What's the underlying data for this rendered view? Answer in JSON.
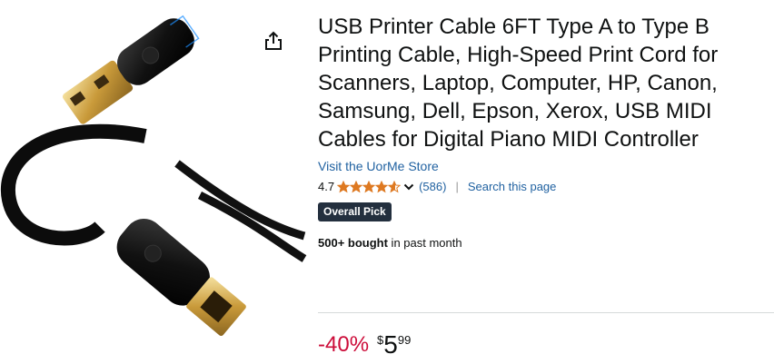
{
  "product": {
    "title": "USB Printer Cable 6FT Type A to Type B Printing Cable, High-Speed Print Cord for Scanners, Laptop, Computer, HP, Canon, Samsung, Dell, Epson, Xerox, USB MIDI Cables for Digital Piano MIDI Controller",
    "store_link": "Visit the UorMe Store",
    "rating": "4.7",
    "rating_stars": 4.7,
    "rating_count": "(586)",
    "search_link": "Search this page",
    "separator": "|",
    "badge": "Overall Pick",
    "bought_bold": "500+ bought",
    "bought_rest": " in past month"
  },
  "price": {
    "discount": "-40%",
    "currency": "$",
    "whole": "5",
    "fraction": "99"
  },
  "icons": {
    "share": "share-icon",
    "stars": "star-rating-icon",
    "chevron": "chevron-down-icon"
  },
  "colors": {
    "link": "#2162a1",
    "star": "#de7921",
    "discount": "#cc0c39",
    "badge_bg": "#232f3e"
  }
}
